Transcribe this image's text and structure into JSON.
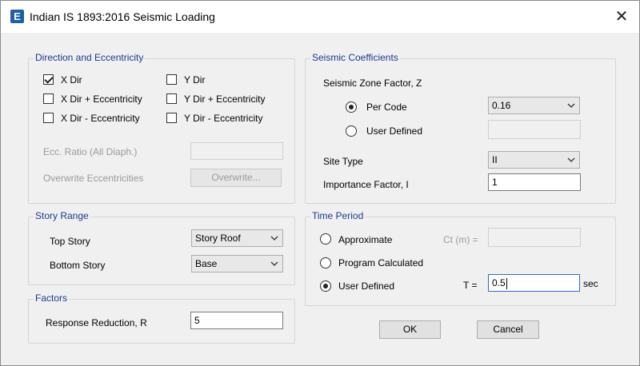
{
  "window": {
    "title": "Indian IS 1893:2016 Seismic Loading",
    "app_icon_letter": "E",
    "close_glyph": "✕"
  },
  "direction": {
    "legend": "Direction and Eccentricity",
    "x_dir": "X Dir",
    "x_dir_plus": "X Dir + Eccentricity",
    "x_dir_minus": "X Dir - Eccentricity",
    "y_dir": "Y Dir",
    "y_dir_plus": "Y Dir + Eccentricity",
    "y_dir_minus": "Y Dir - Eccentricity",
    "ecc_ratio_label": "Ecc. Ratio (All Diaph.)",
    "ecc_ratio_value": "",
    "overwrite_label": "Overwrite Eccentricities",
    "overwrite_button": "Overwrite..."
  },
  "story_range": {
    "legend": "Story Range",
    "top_label": "Top Story",
    "top_value": "Story Roof",
    "bottom_label": "Bottom Story",
    "bottom_value": "Base"
  },
  "factors": {
    "legend": "Factors",
    "response_label": "Response Reduction, R",
    "response_value": "5"
  },
  "seismic": {
    "legend": "Seismic Coefficients",
    "zone_label": "Seismic Zone Factor, Z",
    "per_code": "Per Code",
    "per_code_value": "0.16",
    "user_defined": "User Defined",
    "user_defined_value": "",
    "site_type_label": "Site Type",
    "site_type_value": "II",
    "importance_label": "Importance Factor, I",
    "importance_value": "1"
  },
  "time_period": {
    "legend": "Time Period",
    "approximate": "Approximate",
    "ct_label": "Ct (m) =",
    "ct_value": "",
    "program_calculated": "Program Calculated",
    "user_defined": "User Defined",
    "t_label": "T =",
    "t_value": "0.5",
    "unit": "sec"
  },
  "buttons": {
    "ok": "OK",
    "cancel": "Cancel"
  },
  "icons": {
    "checkmark": "check-icon",
    "dropdown": "chevron-down-icon"
  }
}
